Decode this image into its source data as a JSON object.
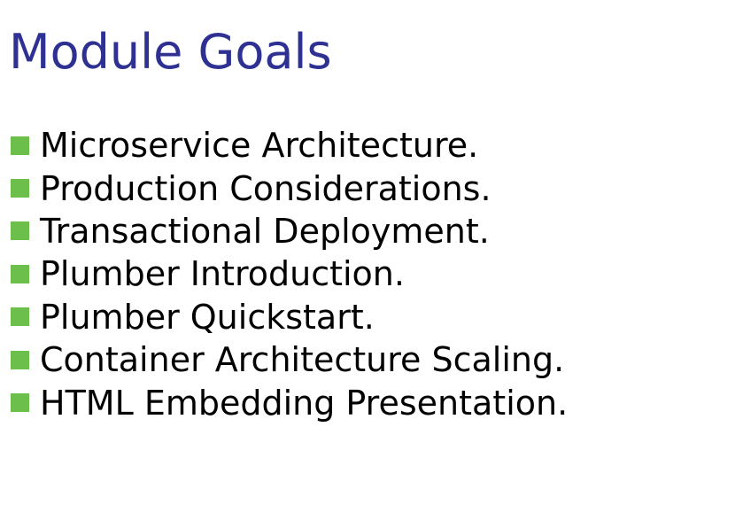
{
  "slide": {
    "title": "Module Goals",
    "bullet_color": "#6cbf4a",
    "title_color": "#2e3192",
    "bullets": [
      "Microservice Architecture.",
      "Production Considerations.",
      "Transactional Deployment.",
      "Plumber Introduction.",
      "Plumber Quickstart.",
      "Container Architecture Scaling.",
      "HTML Embedding Presentation."
    ]
  }
}
